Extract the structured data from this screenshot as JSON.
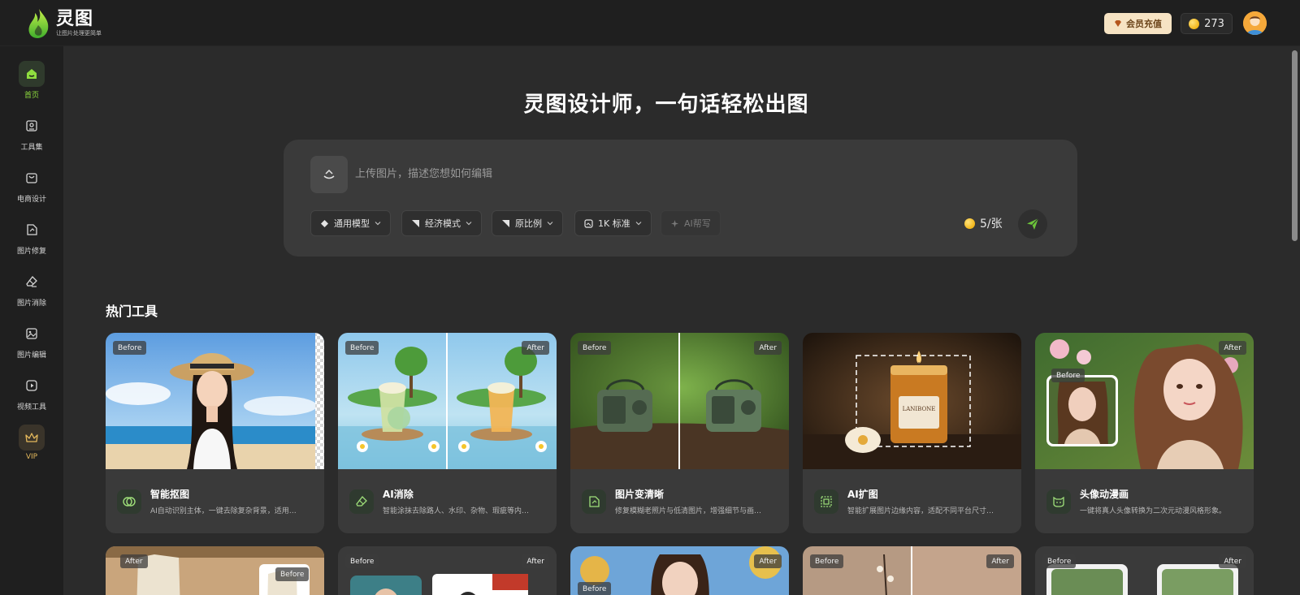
{
  "header": {
    "logo_title": "灵图",
    "logo_subtitle": "让图片处理更简单",
    "vip_label": "会员充值",
    "coin_count": "273"
  },
  "sidebar": {
    "items": [
      {
        "label": "首页",
        "icon": "home-icon",
        "active": true
      },
      {
        "label": "工具集",
        "icon": "toolbox-icon"
      },
      {
        "label": "电商设计",
        "icon": "shopping-bag-icon"
      },
      {
        "label": "图片修复",
        "icon": "image-repair-icon"
      },
      {
        "label": "图片消除",
        "icon": "eraser-icon"
      },
      {
        "label": "图片编辑",
        "icon": "image-edit-icon"
      },
      {
        "label": "视频工具",
        "icon": "video-icon"
      },
      {
        "label": "VIP",
        "icon": "crown-icon"
      }
    ]
  },
  "hero": {
    "title": "灵图设计师，一句话轻松出图"
  },
  "prompt": {
    "placeholder": "上传图片，描述您想如何编辑",
    "chips": [
      {
        "label": "通用模型",
        "icon": "model-icon"
      },
      {
        "label": "经济模式",
        "icon": "mode-icon"
      },
      {
        "label": "原比例",
        "icon": "ratio-icon"
      },
      {
        "label": "1K 标准",
        "icon": "resolution-icon"
      },
      {
        "label": "AI帮写",
        "icon": "ai-write-icon"
      }
    ],
    "price": "5/张"
  },
  "tools": {
    "section_title": "热门工具",
    "before_label": "Before",
    "after_label": "After",
    "cards": [
      {
        "title": "智能抠图",
        "desc": "AI自动识别主体，一键去除复杂背景，适用…",
        "icon": "cutout-icon"
      },
      {
        "title": "AI消除",
        "desc": "智能涂抹去除路人、水印、杂物、瑕疵等内…",
        "icon": "eraser-icon"
      },
      {
        "title": "图片变清晰",
        "desc": "修复模糊老照片与低清图片，增强细节与画…",
        "icon": "enhance-icon"
      },
      {
        "title": "AI扩图",
        "desc": "智能扩展图片边缘内容，适配不同平台尺寸…",
        "icon": "expand-icon"
      },
      {
        "title": "头像动漫画",
        "desc": "一键将真人头像转换为二次元动漫风格形象。",
        "icon": "anime-icon"
      }
    ]
  },
  "colors": {
    "accent_green": "#8fdd3f",
    "vip_gold": "#f6e3c3",
    "panel": "#3a3a3a",
    "background": "#2b2b2b"
  }
}
